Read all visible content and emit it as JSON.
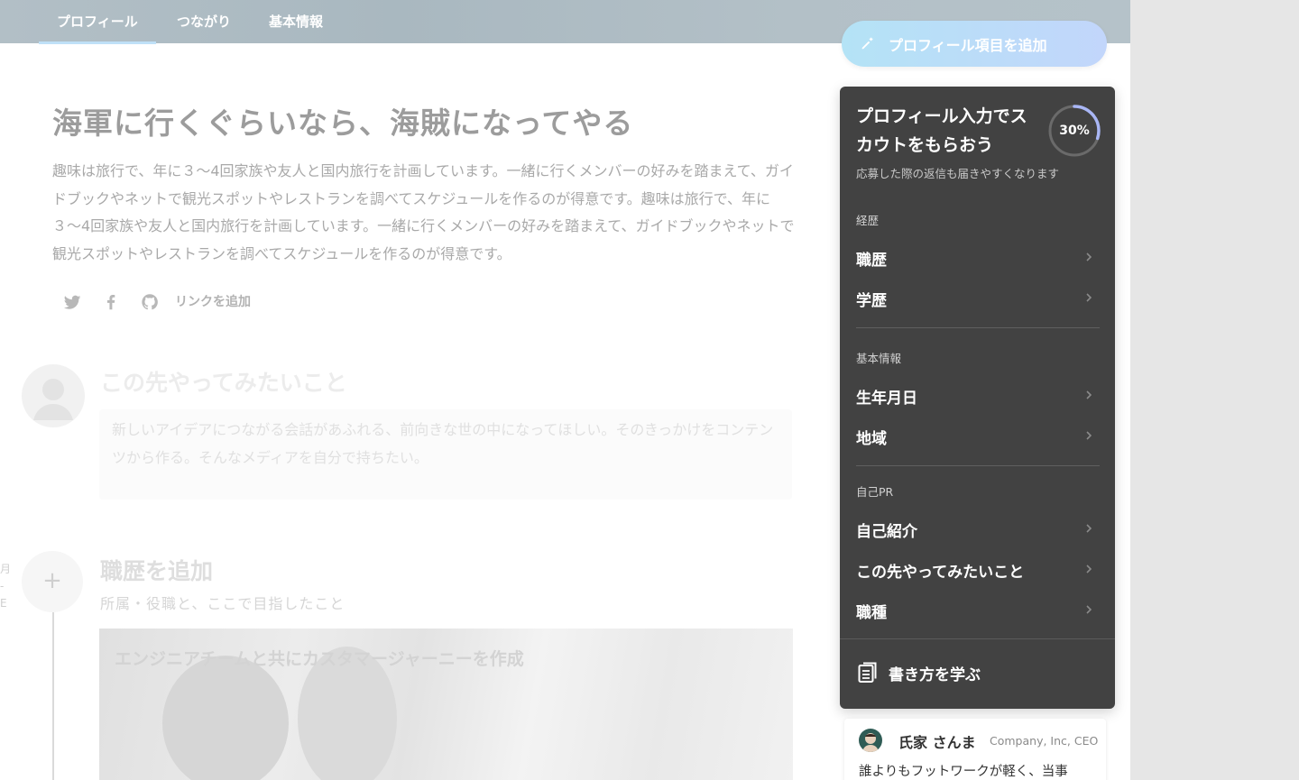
{
  "header": {
    "tabs": [
      {
        "label": "プロフィール",
        "active": true
      },
      {
        "label": "つながり",
        "active": false
      },
      {
        "label": "基本情報",
        "active": false
      }
    ],
    "add_profile_button": "プロフィール項目を追加"
  },
  "profile": {
    "headline": "海軍に行くぐらいなら、海賊になってやる",
    "bio": "趣味は旅行で、年に３〜4回家族や友人と国内旅行を計画しています。一緒に行くメンバーの好みを踏まえて、ガイドブックやネットで観光スポットやレストランを調べてスケジュールを作るのが得意です。趣味は旅行で、年に３〜4回家族や友人と国内旅行を計画しています。一緒に行くメンバーの好みを踏まえて、ガイドブックやネットで観光スポットやレストランを調べてスケジュールを作るのが得意です。",
    "social_icons": [
      "twitter-icon",
      "facebook-icon",
      "github-icon"
    ],
    "add_link": "リンクを追加"
  },
  "future": {
    "title": "この先やってみたいこと",
    "text": "新しいアイデアにつながる会話があふれる、前向きな世の中になってほしい。そのきっかけをコンテンツから作る。そんなメディアを自分で持ちたい。"
  },
  "career": {
    "title": "職歴を追加",
    "subtitle": "所属・役職と、ここで目指したこと",
    "card_caption": "エンジニアチームと共にカスタマージャーニーを作成",
    "edge_text": "月 - E"
  },
  "panel": {
    "title": "プロフィール入力でスカウトをもらおう",
    "subtitle": "応募した際の返信も届きやすくなります",
    "progress": 30,
    "progress_label": "30%",
    "sections": [
      {
        "heading": "経歴",
        "items": [
          "職歴",
          "学歴"
        ]
      },
      {
        "heading": "基本情報",
        "items": [
          "生年月日",
          "地域"
        ]
      },
      {
        "heading": "自己PR",
        "items": [
          "自己紹介",
          "この先やってみたいこと",
          "職種"
        ]
      }
    ],
    "learn_button": "書き方を学ぶ"
  },
  "testimonial": {
    "name": "氏家 さんま",
    "role": "Company, Inc, CEO",
    "quote": "誰よりもフットワークが軽く、当事"
  },
  "colors": {
    "panel_bg": "#424242",
    "progress_accent": "#a9b6f5",
    "button_gradient_start": "#b4e3f6",
    "button_gradient_end": "#c2d6fb"
  }
}
